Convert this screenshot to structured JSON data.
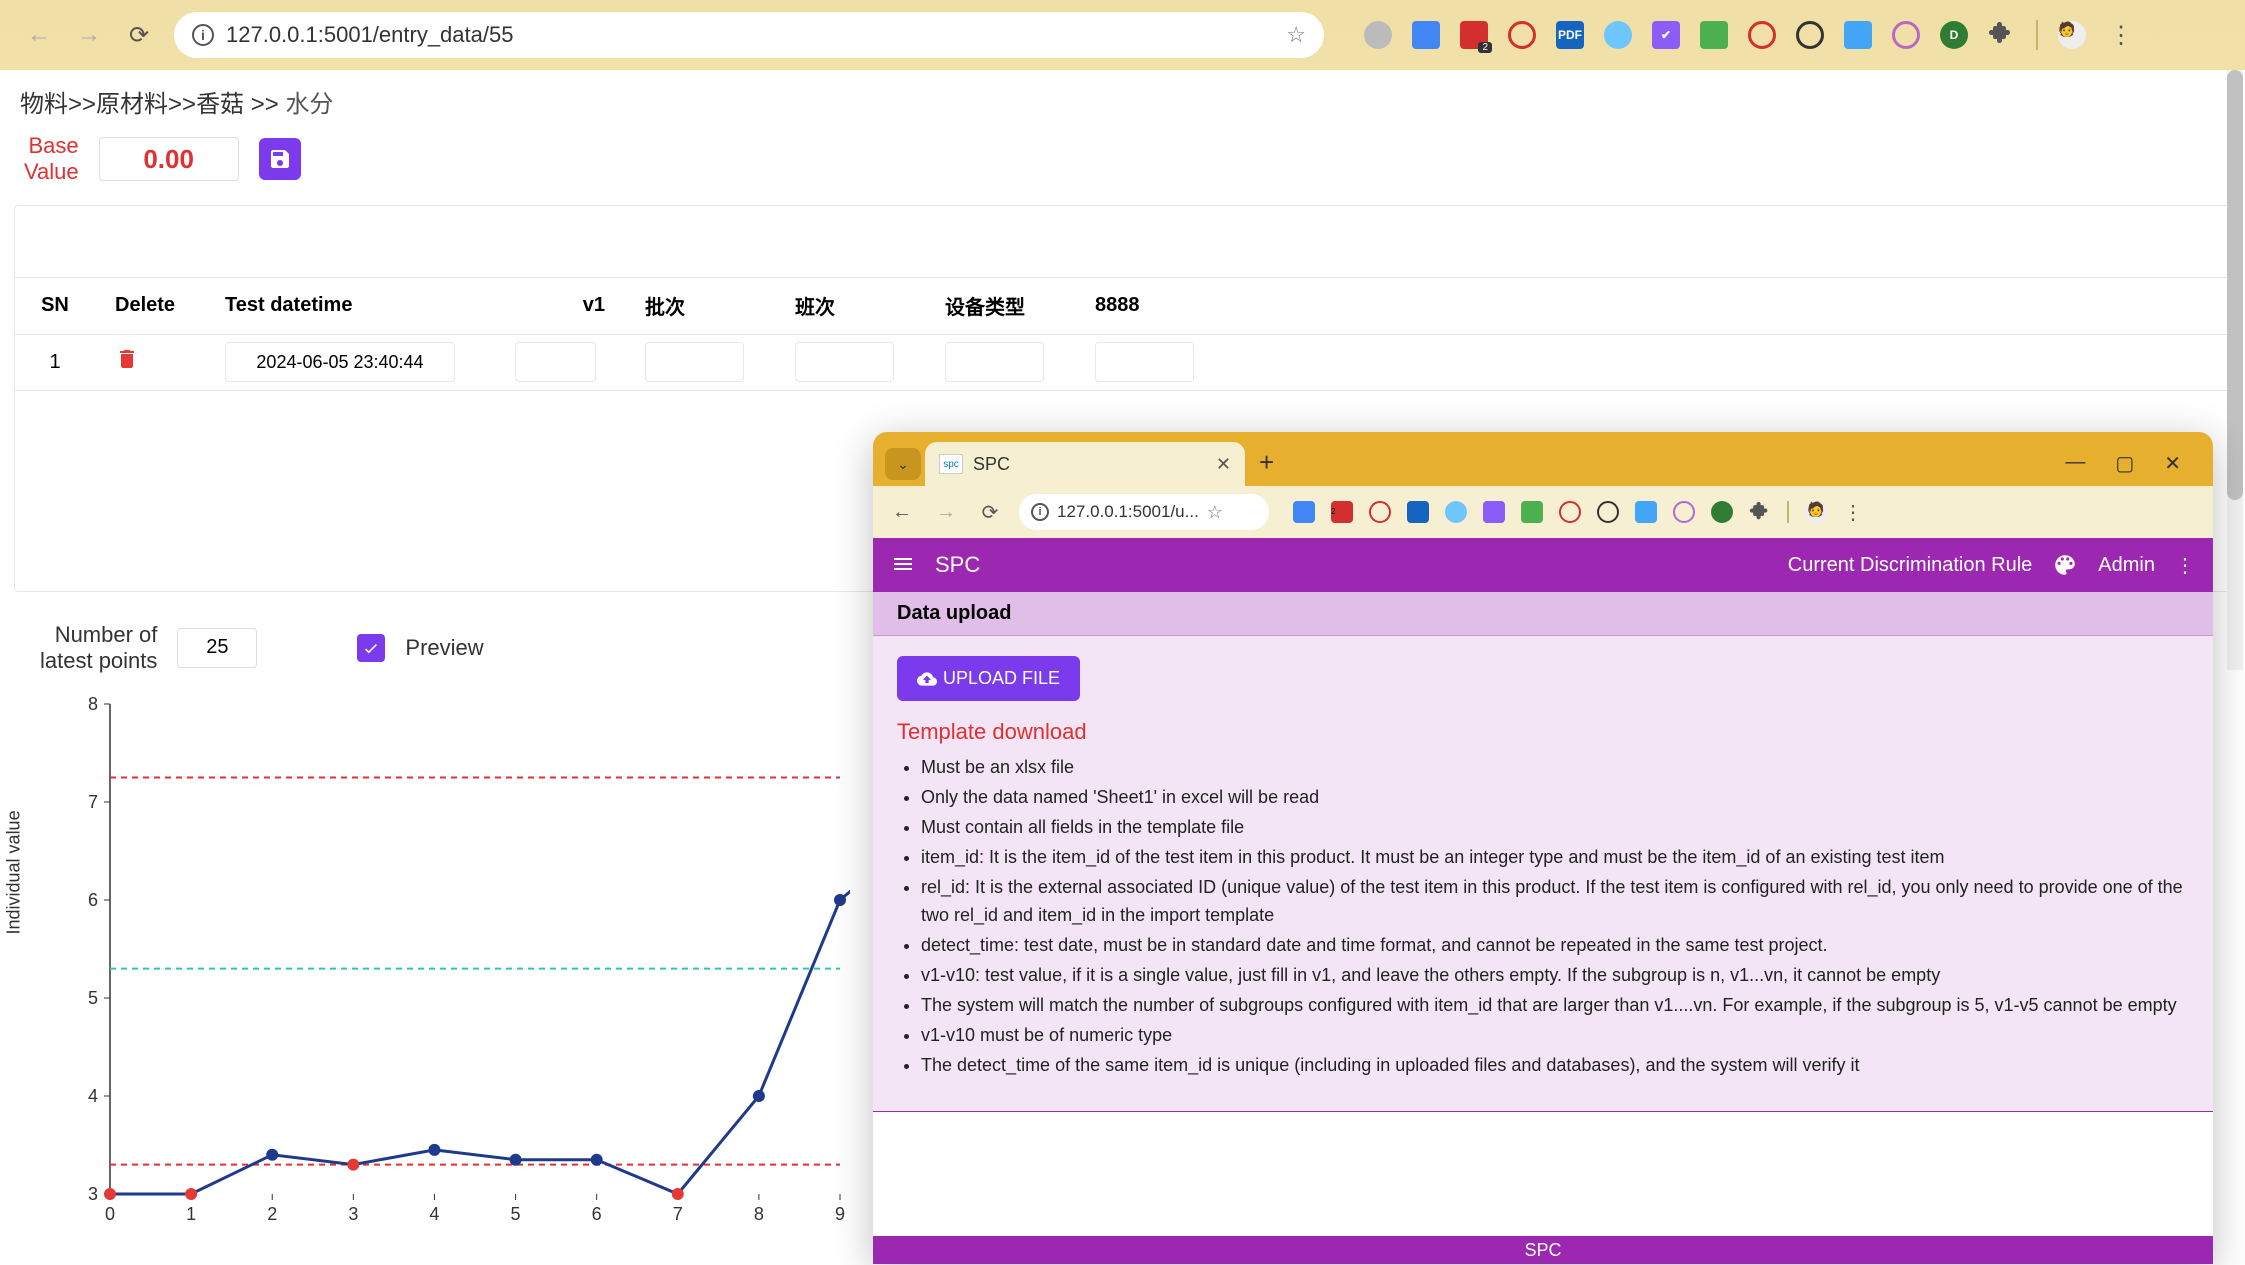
{
  "main_browser": {
    "url": "127.0.0.1:5001/entry_data/55"
  },
  "breadcrumb": {
    "segments": [
      "物料",
      "原材料",
      "香菇"
    ],
    "leaf": "水分"
  },
  "base": {
    "label_l1": "Base",
    "label_l2": "Value",
    "value": "0.00"
  },
  "table": {
    "headers": {
      "sn": "SN",
      "del": "Delete",
      "dt": "Test datetime",
      "v1": "v1",
      "batch": "批次",
      "shift": "班次",
      "device": "设备类型",
      "c8888": "8888"
    },
    "rows": [
      {
        "sn": "1",
        "dt": "2024-06-05 23:40:44",
        "v1": "",
        "batch": "",
        "shift": "",
        "device": "",
        "c8888": ""
      }
    ]
  },
  "controls": {
    "points_label_l1": "Number of",
    "points_label_l2": "latest points",
    "points_value": "25",
    "preview_label": "Preview",
    "preview_checked": true
  },
  "chart_data": {
    "type": "line",
    "title": "",
    "xlabel": "",
    "ylabel": "Individual value",
    "ylim": [
      3,
      8
    ],
    "xlim": [
      0,
      9
    ],
    "x_ticks": [
      0,
      1,
      2,
      3,
      4,
      5,
      6,
      7,
      8,
      9
    ],
    "y_ticks": [
      3,
      4,
      5,
      6,
      7,
      8
    ],
    "series": [
      {
        "name": "value",
        "x": [
          0,
          1,
          2,
          3,
          4,
          5,
          6,
          7,
          8,
          9
        ],
        "y": [
          3.0,
          3.0,
          3.4,
          3.3,
          3.45,
          3.35,
          3.35,
          3.0,
          4.0,
          6.0
        ]
      }
    ],
    "ref_lines": [
      {
        "name": "ucl",
        "y": 7.25,
        "color": "#e03030",
        "dash": true
      },
      {
        "name": "cl",
        "y": 5.3,
        "color": "#2ec4b6",
        "dash": true
      },
      {
        "name": "lcl",
        "y": 3.3,
        "color": "#e03030",
        "dash": true
      }
    ],
    "red_points_x": [
      0,
      1,
      3,
      7
    ],
    "line_continues_right": true,
    "last_visible": {
      "x": 9.5,
      "y": 6.35
    }
  },
  "sec_window": {
    "tab_title": "SPC",
    "url": "127.0.0.1:5001/u...",
    "app_title": "SPC",
    "right_link": "Current Discrimination Rule",
    "user": "Admin",
    "section_title": "Data upload",
    "upload_btn": "UPLOAD FILE",
    "template_link": "Template download",
    "notes": [
      "Must be an xlsx file",
      "Only the data named 'Sheet1' in excel will be read",
      "Must contain all fields in the template file",
      "item_id: It is the item_id of the test item in this product. It must be an integer type and must be the item_id of an existing test item",
      "rel_id: It is the external associated ID (unique value) of the test item in this product. If the test item is configured with rel_id, you only need to provide one of the two rel_id and item_id in the import template",
      "detect_time: test date, must be in standard date and time format, and cannot be repeated in the same test project.",
      "v1-v10: test value, if it is a single value, just fill in v1, and leave the others empty. If the subgroup is n, v1...vn, it cannot be empty",
      "The system will match the number of subgroups configured with item_id that are larger than v1....vn. For example, if the subgroup is 5, v1-v5 cannot be empty",
      "v1-v10 must be of numeric type",
      "The detect_time of the same item_id is unique (including in uploaded files and databases), and the system will verify it"
    ],
    "footer": "SPC"
  }
}
